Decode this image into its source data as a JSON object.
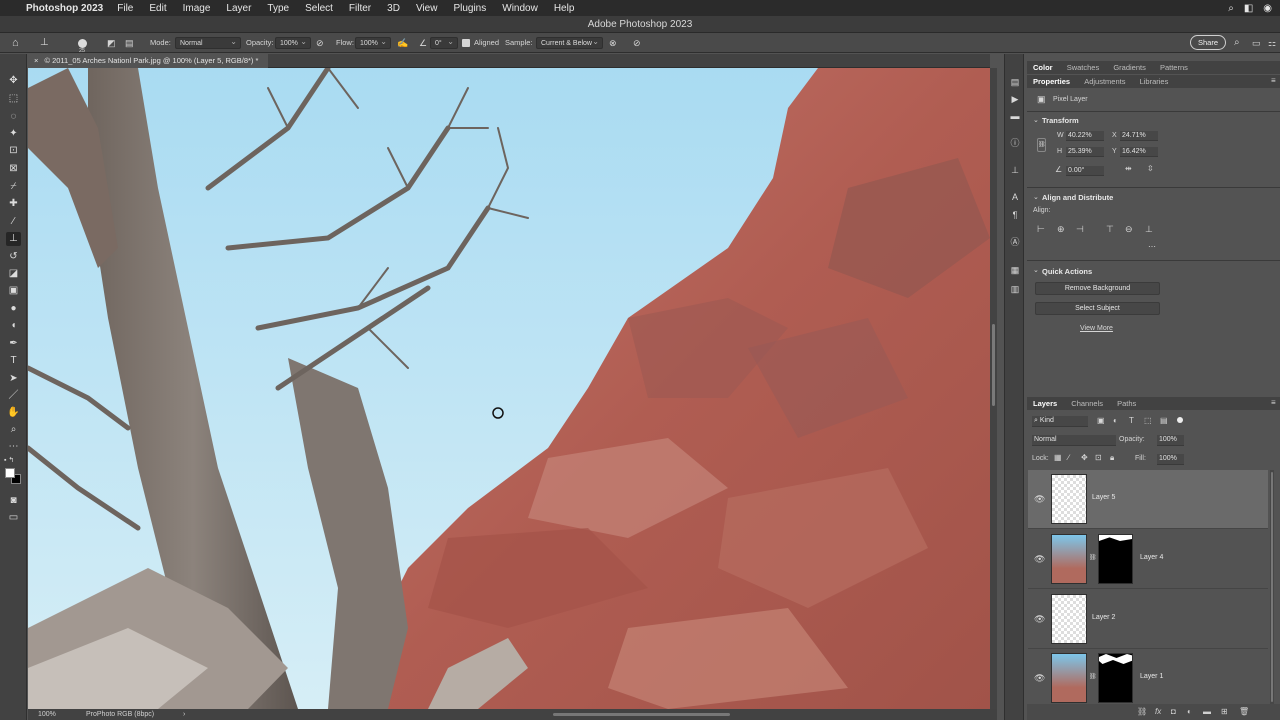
{
  "menubar": {
    "app_name": "Photoshop 2023",
    "items": [
      "File",
      "Edit",
      "Image",
      "Layer",
      "Type",
      "Select",
      "Filter",
      "3D",
      "View",
      "Plugins",
      "Window",
      "Help"
    ]
  },
  "window_title": "Adobe Photoshop 2023",
  "options_bar": {
    "brush_size": "25",
    "mode_label": "Mode:",
    "mode_value": "Normal",
    "opacity_label": "Opacity:",
    "opacity_value": "100%",
    "flow_label": "Flow:",
    "flow_value": "100%",
    "angle_value": "0°",
    "aligned_label": "Aligned",
    "sample_label": "Sample:",
    "sample_value": "Current & Below",
    "share_label": "Share"
  },
  "document_tab": {
    "label": "© 2011_05 Arches Nationl Park.jpg @ 100% (Layer 5, RGB/8*) *"
  },
  "status_bar": {
    "zoom": "100%",
    "profile": "ProPhoto RGB (8bpc)"
  },
  "panels": {
    "top_tabs": [
      "Color",
      "Swatches",
      "Gradients",
      "Patterns"
    ],
    "prop_tabs": [
      "Properties",
      "Adjustments",
      "Libraries"
    ],
    "pixel_layer_label": "Pixel Layer",
    "transform": {
      "title": "Transform",
      "w_label": "W",
      "w_value": "40.22%",
      "x_label": "X",
      "x_value": "24.71%",
      "h_label": "H",
      "h_value": "25.39%",
      "y_label": "Y",
      "y_value": "16.42%",
      "angle_value": "0.00°"
    },
    "align": {
      "title": "Align and Distribute",
      "align_label": "Align:"
    },
    "quick_actions": {
      "title": "Quick Actions",
      "remove_background": "Remove Background",
      "select_subject": "Select Subject",
      "view_more": "View More"
    },
    "layers_tabs": [
      "Layers",
      "Channels",
      "Paths"
    ],
    "layers_filter": "Kind",
    "blend_mode": "Normal",
    "opacity_label": "Opacity:",
    "opacity_value": "100%",
    "lock_label": "Lock:",
    "fill_label": "Fill:",
    "fill_value": "100%",
    "layers": [
      {
        "name": "Layer 5"
      },
      {
        "name": "Layer 4"
      },
      {
        "name": "Layer 2"
      },
      {
        "name": "Layer 1"
      }
    ]
  },
  "colors": {
    "sky": "#b8e0f3",
    "rock": "#b9665a",
    "panel": "#535353"
  }
}
